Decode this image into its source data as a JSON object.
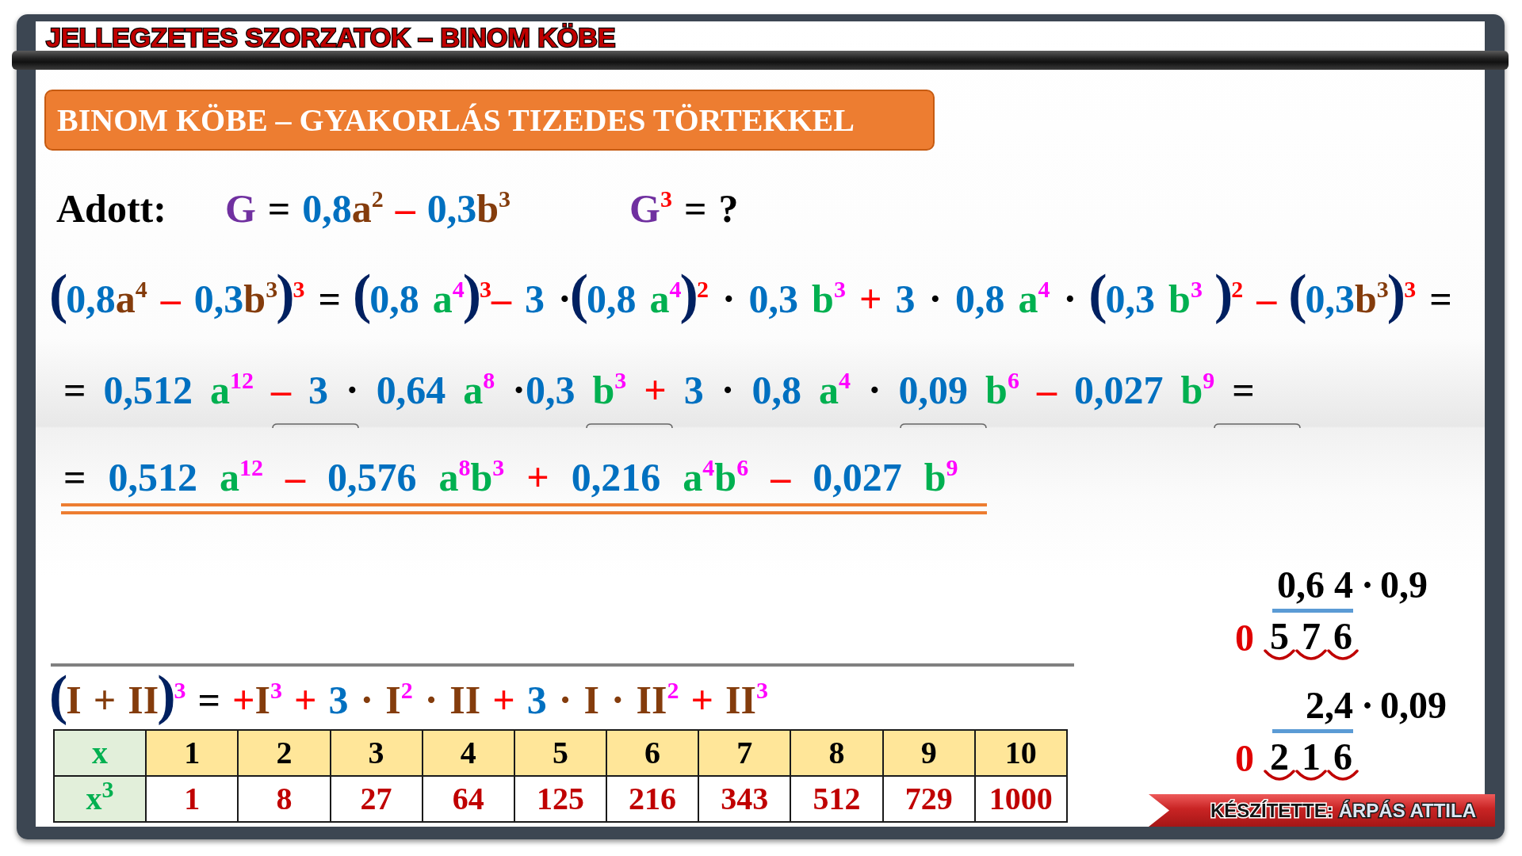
{
  "header": {
    "title": "JELLEGZETES SZORZATOK – BINOM KÖBE"
  },
  "banner": {
    "title": "BINOM KÖBE – GYAKORLÁS TIZEDES TÖRTEKKEL"
  },
  "given": {
    "label": "Adott:",
    "expressions": [
      [
        [
          {
            "text": "G",
            "kind": "var",
            "color": "#7030a0"
          }
        ],
        [
          {
            "text": "=",
            "kind": "eq",
            "color": "#000000"
          }
        ],
        [
          {
            "text": "0,8",
            "kind": "num",
            "color": "#0070c0"
          },
          {
            "text": "a",
            "kind": "var",
            "color": "#843c0c"
          },
          {
            "text": "2",
            "kind": "sup",
            "color": "#843c0c"
          }
        ],
        [
          {
            "text": "–",
            "kind": "op",
            "color": "#ff0000"
          }
        ],
        [
          {
            "text": "0,3",
            "kind": "num",
            "color": "#0070c0"
          },
          {
            "text": "b",
            "kind": "var",
            "color": "#843c0c"
          },
          {
            "text": "3",
            "kind": "sup",
            "color": "#843c0c"
          }
        ]
      ],
      [
        [
          {
            "text": "G",
            "kind": "var",
            "color": "#7030a0"
          },
          {
            "text": "3",
            "kind": "sup",
            "color": "#ff0000"
          }
        ],
        [
          {
            "text": "=",
            "kind": "eq",
            "color": "#000000"
          }
        ],
        [
          {
            "text": "?",
            "kind": "mark",
            "color": "#000000"
          }
        ]
      ]
    ]
  },
  "derivation": {
    "lines": [
      {
        "kind": "expansion",
        "terms": [
          [
            {
              "text": "(",
              "kind": "open",
              "color": "#002060"
            },
            {
              "text": "0,8",
              "kind": "num",
              "color": "#0070c0"
            },
            {
              "text": "a",
              "kind": "var",
              "color": "#843c0c"
            },
            {
              "text": "4",
              "kind": "sup",
              "color": "#843c0c"
            }
          ],
          [
            {
              "text": "–",
              "kind": "op",
              "color": "#ff0000"
            }
          ],
          [
            {
              "text": "0,3",
              "kind": "num",
              "color": "#0070c0"
            },
            {
              "text": "b",
              "kind": "var",
              "color": "#843c0c"
            },
            {
              "text": "3",
              "kind": "sup",
              "color": "#843c0c"
            },
            {
              "text": ")",
              "kind": "close",
              "color": "#002060"
            },
            {
              "text": "3",
              "kind": "sup",
              "color": "#ff0000"
            }
          ],
          [
            {
              "text": "=",
              "kind": "eq",
              "color": "#000000"
            }
          ],
          [
            {
              "text": "(",
              "kind": "open",
              "color": "#002060"
            },
            {
              "text": "0,8",
              "kind": "num",
              "color": "#0070c0"
            }
          ],
          [
            {
              "text": "a",
              "kind": "var",
              "color": "#00b050"
            },
            {
              "text": "4",
              "kind": "sup",
              "color": "#ff00ff"
            },
            {
              "text": ")",
              "kind": "close",
              "color": "#002060"
            },
            {
              "text": "3",
              "kind": "sup",
              "color": "#ff0000"
            },
            {
              "text": "–",
              "kind": "op",
              "color": "#ff0000"
            }
          ],
          [
            {
              "text": "3",
              "kind": "num",
              "color": "#0070c0"
            }
          ],
          [
            {
              "text": "·",
              "kind": "dot",
              "color": "#000000"
            },
            {
              "text": "(",
              "kind": "open",
              "color": "#002060"
            },
            {
              "text": "0,8",
              "kind": "num",
              "color": "#0070c0"
            }
          ],
          [
            {
              "text": "a",
              "kind": "var",
              "color": "#00b050"
            },
            {
              "text": "4",
              "kind": "sup",
              "color": "#ff00ff"
            },
            {
              "text": ")",
              "kind": "close",
              "color": "#002060"
            },
            {
              "text": "2",
              "kind": "sup",
              "color": "#ff0000"
            }
          ],
          [
            {
              "text": "·",
              "kind": "dot",
              "color": "#000000"
            }
          ],
          [
            {
              "text": "0,3",
              "kind": "num",
              "color": "#0070c0"
            }
          ],
          [
            {
              "text": "b",
              "kind": "var",
              "color": "#00b050"
            },
            {
              "text": "3",
              "kind": "sup",
              "color": "#ff00ff"
            }
          ],
          [
            {
              "text": "+",
              "kind": "op",
              "color": "#ff0000"
            }
          ],
          [
            {
              "text": "3",
              "kind": "num",
              "color": "#0070c0"
            }
          ],
          [
            {
              "text": "·",
              "kind": "dot",
              "color": "#000000"
            }
          ],
          [
            {
              "text": "0,8",
              "kind": "num",
              "color": "#0070c0"
            }
          ],
          [
            {
              "text": "a",
              "kind": "var",
              "color": "#00b050"
            },
            {
              "text": "4",
              "kind": "sup",
              "color": "#ff00ff"
            }
          ],
          [
            {
              "text": "·",
              "kind": "dot",
              "color": "#000000"
            }
          ],
          [
            {
              "text": "(",
              "kind": "open",
              "color": "#002060"
            },
            {
              "text": "0,3",
              "kind": "num",
              "color": "#0070c0"
            }
          ],
          [
            {
              "text": "b",
              "kind": "var",
              "color": "#00b050"
            },
            {
              "text": "3",
              "kind": "sup",
              "color": "#ff00ff"
            }
          ],
          [
            {
              "text": ")",
              "kind": "close",
              "color": "#002060"
            },
            {
              "text": "2",
              "kind": "sup",
              "color": "#ff0000"
            }
          ],
          [
            {
              "text": "–",
              "kind": "op",
              "color": "#ff0000"
            }
          ],
          [
            {
              "text": "(",
              "kind": "open",
              "color": "#002060"
            },
            {
              "text": "0,3",
              "kind": "num",
              "color": "#0070c0"
            },
            {
              "text": "b",
              "kind": "var",
              "color": "#843c0c"
            },
            {
              "text": "3",
              "kind": "sup",
              "color": "#843c0c"
            },
            {
              "text": ")",
              "kind": "close",
              "color": "#002060"
            },
            {
              "text": "3",
              "kind": "sup",
              "color": "#ff0000"
            }
          ],
          [
            {
              "text": "=",
              "kind": "eq",
              "color": "#000000"
            }
          ]
        ]
      },
      {
        "kind": "step",
        "terms": [
          [
            {
              "text": "=",
              "kind": "eq",
              "color": "#000000"
            }
          ],
          [
            {
              "text": "0,512",
              "kind": "num",
              "color": "#0070c0"
            }
          ],
          [
            {
              "text": "a",
              "kind": "var",
              "color": "#00b050"
            },
            {
              "text": "12",
              "kind": "sup",
              "color": "#ff00ff"
            }
          ],
          [
            {
              "text": "–",
              "kind": "op",
              "color": "#ff0000"
            }
          ],
          [
            {
              "text": "3",
              "kind": "num",
              "color": "#0070c0"
            }
          ],
          [
            {
              "text": "·",
              "kind": "dot",
              "color": "#000000"
            }
          ],
          [
            {
              "text": "0,64",
              "kind": "num",
              "color": "#0070c0"
            }
          ],
          [
            {
              "text": "a",
              "kind": "var",
              "color": "#00b050"
            },
            {
              "text": "8",
              "kind": "sup",
              "color": "#ff00ff"
            }
          ],
          [
            {
              "text": "·",
              "kind": "dot",
              "color": "#000000"
            },
            {
              "text": "0,3",
              "kind": "num",
              "color": "#0070c0"
            }
          ],
          [
            {
              "text": "b",
              "kind": "var",
              "color": "#00b050"
            },
            {
              "text": "3",
              "kind": "sup",
              "color": "#ff00ff"
            }
          ],
          [
            {
              "text": "+",
              "kind": "op",
              "color": "#ff0000"
            }
          ],
          [
            {
              "text": "3",
              "kind": "num",
              "color": "#0070c0"
            }
          ],
          [
            {
              "text": "·",
              "kind": "dot",
              "color": "#000000"
            }
          ],
          [
            {
              "text": "0,8",
              "kind": "num",
              "color": "#0070c0"
            }
          ],
          [
            {
              "text": "a",
              "kind": "var",
              "color": "#00b050"
            },
            {
              "text": "4",
              "kind": "sup",
              "color": "#ff00ff"
            }
          ],
          [
            {
              "text": "·",
              "kind": "dot",
              "color": "#000000"
            }
          ],
          [
            {
              "text": "0,09",
              "kind": "num",
              "color": "#0070c0"
            }
          ],
          [
            {
              "text": "b",
              "kind": "var",
              "color": "#00b050"
            },
            {
              "text": "6",
              "kind": "sup",
              "color": "#ff00ff"
            }
          ],
          [
            {
              "text": "–",
              "kind": "op",
              "color": "#ff0000"
            }
          ],
          [
            {
              "text": "0,027",
              "kind": "num",
              "color": "#0070c0"
            }
          ],
          [
            {
              "text": "b",
              "kind": "var",
              "color": "#00b050"
            },
            {
              "text": "9",
              "kind": "sup",
              "color": "#ff00ff"
            }
          ],
          [
            {
              "text": "=",
              "kind": "eq",
              "color": "#000000"
            }
          ]
        ]
      },
      {
        "kind": "result",
        "terms": [
          [
            {
              "text": "=",
              "kind": "eq",
              "color": "#000000"
            }
          ],
          [
            {
              "text": "0,512",
              "kind": "num",
              "color": "#0070c0"
            }
          ],
          [
            {
              "text": "a",
              "kind": "var",
              "color": "#00b050"
            },
            {
              "text": "12",
              "kind": "sup",
              "color": "#ff00ff"
            }
          ],
          [
            {
              "text": "–",
              "kind": "op",
              "color": "#ff0000"
            }
          ],
          [
            {
              "text": "0,576",
              "kind": "num",
              "color": "#0070c0"
            }
          ],
          [
            {
              "text": "a",
              "kind": "var",
              "color": "#00b050"
            },
            {
              "text": "8",
              "kind": "sup",
              "color": "#ff00ff"
            },
            {
              "text": "b",
              "kind": "var",
              "color": "#00b050"
            },
            {
              "text": "3",
              "kind": "sup",
              "color": "#ff00ff"
            }
          ],
          [
            {
              "text": "+",
              "kind": "op",
              "color": "#ff0000"
            }
          ],
          [
            {
              "text": "0,216",
              "kind": "num",
              "color": "#0070c0"
            }
          ],
          [
            {
              "text": "a",
              "kind": "var",
              "color": "#00b050"
            },
            {
              "text": "4",
              "kind": "sup",
              "color": "#ff00ff"
            },
            {
              "text": "b",
              "kind": "var",
              "color": "#00b050"
            },
            {
              "text": "6",
              "kind": "sup",
              "color": "#ff00ff"
            }
          ],
          [
            {
              "text": "–",
              "kind": "op",
              "color": "#ff0000"
            }
          ],
          [
            {
              "text": "0,027",
              "kind": "num",
              "color": "#0070c0"
            }
          ],
          [
            {
              "text": "b",
              "kind": "var",
              "color": "#00b050"
            },
            {
              "text": "9",
              "kind": "sup",
              "color": "#ff00ff"
            }
          ]
        ]
      }
    ]
  },
  "identity": {
    "terms": [
      [
        {
          "text": "(",
          "kind": "open",
          "color": "#002060"
        },
        {
          "text": "I",
          "kind": "var",
          "color": "#843c0c"
        }
      ],
      [
        {
          "text": "+",
          "kind": "op",
          "color": "#843c0c"
        }
      ],
      [
        {
          "text": "II",
          "kind": "var",
          "color": "#843c0c"
        },
        {
          "text": ")",
          "kind": "close",
          "color": "#002060"
        },
        {
          "text": "3",
          "kind": "sup",
          "color": "#ff00ff"
        }
      ],
      [
        {
          "text": "=",
          "kind": "eq",
          "color": "#000000"
        }
      ],
      [
        {
          "text": "+",
          "kind": "op",
          "color": "#ff0000"
        },
        {
          "text": "I",
          "kind": "var",
          "color": "#843c0c"
        },
        {
          "text": "3",
          "kind": "sup",
          "color": "#ff00ff"
        }
      ],
      [
        {
          "text": "+",
          "kind": "op",
          "color": "#ff0000"
        }
      ],
      [
        {
          "text": "3",
          "kind": "num",
          "color": "#0070c0"
        }
      ],
      [
        {
          "text": "·",
          "kind": "dot",
          "color": "#843c0c"
        }
      ],
      [
        {
          "text": "I",
          "kind": "var",
          "color": "#843c0c"
        },
        {
          "text": "2",
          "kind": "sup",
          "color": "#ff00ff"
        }
      ],
      [
        {
          "text": "·",
          "kind": "dot",
          "color": "#843c0c"
        }
      ],
      [
        {
          "text": "II",
          "kind": "var",
          "color": "#843c0c"
        }
      ],
      [
        {
          "text": "+",
          "kind": "op",
          "color": "#ff0000"
        }
      ],
      [
        {
          "text": "3",
          "kind": "num",
          "color": "#0070c0"
        }
      ],
      [
        {
          "text": "·",
          "kind": "dot",
          "color": "#843c0c"
        }
      ],
      [
        {
          "text": "I",
          "kind": "var",
          "color": "#843c0c"
        }
      ],
      [
        {
          "text": "·",
          "kind": "dot",
          "color": "#843c0c"
        }
      ],
      [
        {
          "text": "II",
          "kind": "var",
          "color": "#843c0c"
        },
        {
          "text": "2",
          "kind": "sup",
          "color": "#ff00ff"
        }
      ],
      [
        {
          "text": "+",
          "kind": "op",
          "color": "#ff0000"
        }
      ],
      [
        {
          "text": "II",
          "kind": "var",
          "color": "#843c0c"
        },
        {
          "text": "3",
          "kind": "sup",
          "color": "#ff00ff"
        }
      ]
    ]
  },
  "table": {
    "rows": [
      {
        "kind": "base",
        "header": "x",
        "cells": [
          "1",
          "2",
          "3",
          "4",
          "5",
          "6",
          "7",
          "8",
          "9",
          "10"
        ]
      },
      {
        "kind": "cube",
        "header": "x$^{3}$",
        "cells": [
          "1",
          "8",
          "27",
          "64",
          "125",
          "216",
          "343",
          "512",
          "729",
          "1000"
        ]
      }
    ]
  },
  "side_calculations": [
    {
      "factor_1": "0,6 4",
      "operator": "·",
      "factor_2": "0,9",
      "prefix": "0",
      "digits": [
        "5",
        "7",
        "6"
      ]
    },
    {
      "factor_1": "2,4",
      "operator": "·",
      "factor_2": "0,09",
      "prefix": "0",
      "digits": [
        "2",
        "1",
        "6"
      ]
    }
  ],
  "credit": {
    "label": "KÉSZÍTETTE:",
    "name": "ÁRPÁS ATTILA"
  }
}
